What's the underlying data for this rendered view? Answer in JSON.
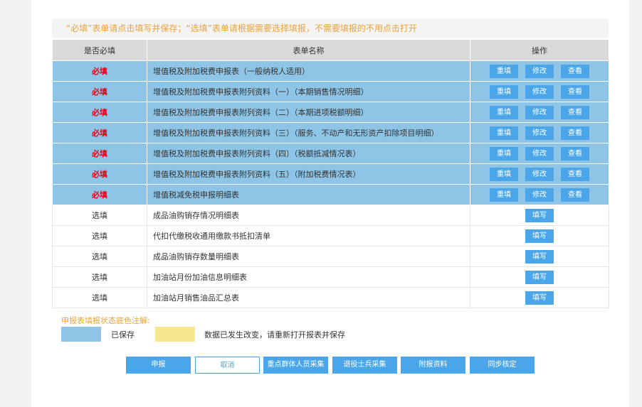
{
  "notice": "“必填”表单请点击填写并保存；“选填”表单请根据需要选择填报，不需要填报的不用点击打开",
  "table": {
    "headers": [
      "是否必填",
      "表单名称",
      "操作"
    ],
    "rows": [
      {
        "status": "必填",
        "name": "增值税及附加税费申报表（一般纳税人适用）",
        "actions": [
          "重填",
          "修改",
          "查看"
        ]
      },
      {
        "status": "必填",
        "name": "增值税及附加税费申报表附列资料（一）（本期销售情况明细）",
        "actions": [
          "重填",
          "修改",
          "查看"
        ]
      },
      {
        "status": "必填",
        "name": "增值税及附加税费申报表附列资料（二）（本期进项税额明细）",
        "actions": [
          "重填",
          "修改",
          "查看"
        ]
      },
      {
        "status": "必填",
        "name": "增值税及附加税费申报表附列资料（三）（服务、不动产和无形资产扣除项目明细）",
        "actions": [
          "重填",
          "修改",
          "查看"
        ]
      },
      {
        "status": "必填",
        "name": "增值税及附加税费申报表附列资料（四）（税额抵减情况表）",
        "actions": [
          "重填",
          "修改",
          "查看"
        ]
      },
      {
        "status": "必填",
        "name": "增值税及附加税费申报表附列资料（五）（附加税费情况表）",
        "actions": [
          "重填",
          "修改",
          "查看"
        ]
      },
      {
        "status": "必填",
        "name": "增值税减免税申报明细表",
        "actions": [
          "重填",
          "修改",
          "查看"
        ]
      },
      {
        "status": "选填",
        "name": "成品油购销存情况明细表",
        "actions": [
          "填写"
        ]
      },
      {
        "status": "选填",
        "name": "代扣代缴税收通用缴款书抵扣清单",
        "actions": [
          "填写"
        ]
      },
      {
        "status": "选填",
        "name": "成品油购销存数量明细表",
        "actions": [
          "填写"
        ]
      },
      {
        "status": "选填",
        "name": "加油站月份加油信息明细表",
        "actions": [
          "填写"
        ]
      },
      {
        "status": "选填",
        "name": "加油站月销售油品汇总表",
        "actions": [
          "填写"
        ]
      }
    ]
  },
  "legend": {
    "title": "申报表填报状态底色注解:",
    "saved_label": "已保存",
    "changed_label": "数据已发生改变，请重新打开报表并保存",
    "saved_color": "#8ec5e6",
    "changed_color": "#f6e88f"
  },
  "buttons": {
    "submit": "申报",
    "cancel": "取消",
    "key_group": "重点群体人员采集",
    "veteran": "退役士兵采集",
    "attachment": "附报资料",
    "sync": "同步核定"
  },
  "colors": {
    "accent": "#4aa6e8",
    "required_row": "#8ec5e6",
    "required_text": "#e60012",
    "notice_text": "#e8a33b"
  }
}
